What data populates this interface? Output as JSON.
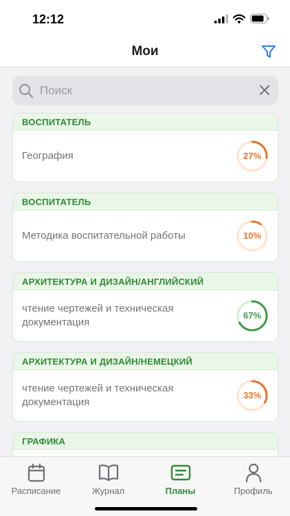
{
  "status": {
    "time": "12:12"
  },
  "header": {
    "title": "Мои"
  },
  "search": {
    "placeholder": "Поиск",
    "value": ""
  },
  "cards": [
    {
      "group": "ВОСПИТАТЕЛЬ",
      "title": "География",
      "progress": 27,
      "label": "27%",
      "color": "#e9722a",
      "track": "#fde3cf"
    },
    {
      "group": "ВОСПИТАТЕЛЬ",
      "title": "Методика воспитательной работы",
      "progress": 10,
      "label": "10%",
      "color": "#e9722a",
      "track": "#fde3cf"
    },
    {
      "group": "АРХИТЕКТУРА И ДИЗАЙН/АНГЛИЙСКИЙ",
      "title": "чтение чертежей и техническая документация",
      "progress": 67,
      "label": "67%",
      "color": "#3c9b45",
      "track": "#d6efd4"
    },
    {
      "group": "АРХИТЕКТУРА И ДИЗАЙН/НЕМЕЦКИЙ",
      "title": "чтение чертежей и техническая документация",
      "progress": 33,
      "label": "33%",
      "color": "#e9722a",
      "track": "#fde3cf"
    },
    {
      "group": "ГРАФИКА",
      "title": "",
      "progress": null,
      "label": "",
      "color": "#e9722a",
      "track": "#fde3cf"
    }
  ],
  "tabs": [
    {
      "label": "Расписание",
      "icon": "calendar-icon",
      "active": false
    },
    {
      "label": "Журнал",
      "icon": "book-icon",
      "active": false
    },
    {
      "label": "Планы",
      "icon": "plans-icon",
      "active": true
    },
    {
      "label": "Профиль",
      "icon": "profile-icon",
      "active": false
    }
  ],
  "colors": {
    "accent_green": "#2f8a35",
    "accent_orange": "#e9722a",
    "filter_blue": "#2f7cf6"
  }
}
